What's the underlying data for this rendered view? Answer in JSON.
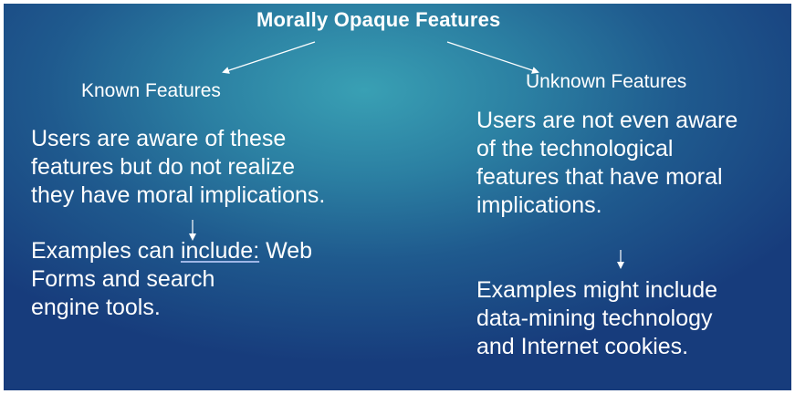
{
  "title": "Morally Opaque Features",
  "known": {
    "heading": "Known Features",
    "description_lines": [
      "Users are aware of these",
      "features but do not realize",
      "they have moral implications."
    ],
    "examples_line1_prefix": "Examples can ",
    "examples_line1_link": "include:",
    "examples_line1_suffix": " Web",
    "examples_lines_rest": [
      "Forms and search",
      "engine tools."
    ]
  },
  "unknown": {
    "heading": "Unknown Features",
    "description_lines": [
      "Users are not even aware",
      "of the technological",
      "features that have moral",
      "implications."
    ],
    "examples_lines": [
      "Examples might include",
      "data-mining technology",
      "and Internet cookies."
    ]
  },
  "colors": {
    "text": "#ffffff",
    "background_center": "#39a0b4",
    "background_edge": "#173c7c"
  }
}
